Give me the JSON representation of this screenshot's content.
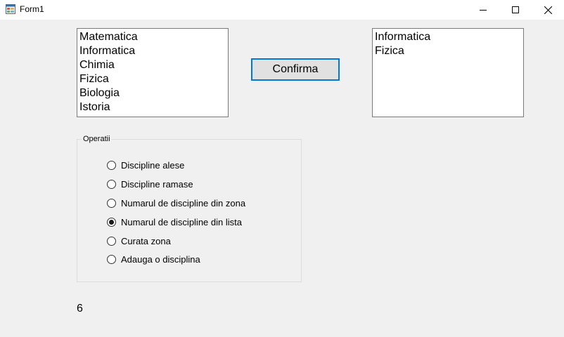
{
  "window": {
    "title": "Form1",
    "icon": "winforms-app-icon",
    "controls": [
      "minimize-icon",
      "maximize-icon",
      "close-icon"
    ]
  },
  "left_list": {
    "items": [
      "Matematica",
      "Informatica",
      "Chimia",
      "Fizica",
      "Biologia",
      "Istoria"
    ]
  },
  "right_list": {
    "items": [
      "Informatica",
      "Fizica"
    ]
  },
  "confirm_button": {
    "label": "Confirma"
  },
  "operations": {
    "title": "Operatii",
    "selected": "Numarul de discipline din lista",
    "options": [
      "Discipline alese",
      "Discipline ramase",
      "Numarul de discipline din zona",
      "Numarul de discipline din lista",
      "Curata zona",
      "Adauga o disciplina"
    ]
  },
  "result": {
    "value": "6"
  },
  "colors": {
    "accent": "#0078d7",
    "background": "#f0f0f0"
  }
}
